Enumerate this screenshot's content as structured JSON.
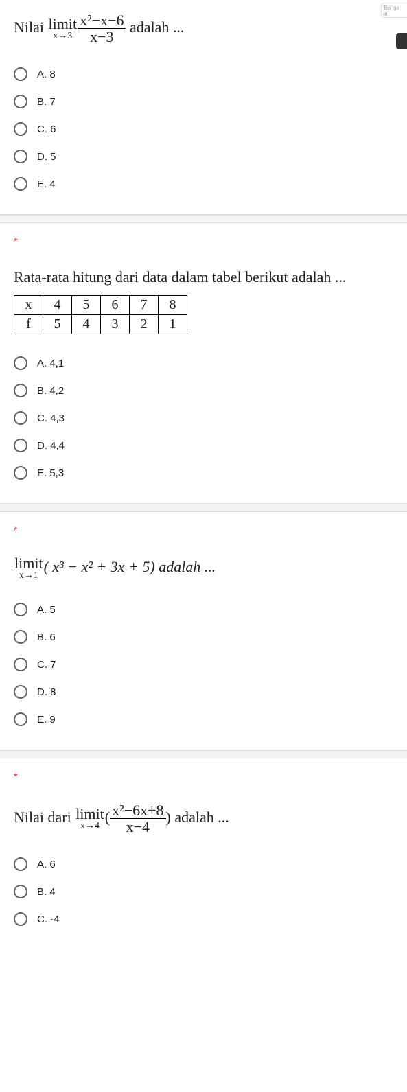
{
  "badge_text": "'Ba' ga ar",
  "required_marker": "*",
  "questions": [
    {
      "prefix": "Nilai ",
      "limit_top": "limit",
      "limit_bot": "x→3",
      "frac_num": "x²−x−6",
      "frac_den": "x−3",
      "suffix": " adalah ...",
      "options": [
        {
          "label": "A. 8"
        },
        {
          "label": "B. 7"
        },
        {
          "label": "C. 6"
        },
        {
          "label": "D. 5"
        },
        {
          "label": "E. 4"
        }
      ]
    },
    {
      "title_text": "Rata-rata hitung dari data dalam tabel berikut adalah ...",
      "table": {
        "row1": [
          "x",
          "4",
          "5",
          "6",
          "7",
          "8"
        ],
        "row2": [
          "f",
          "5",
          "4",
          "3",
          "2",
          "1"
        ]
      },
      "options": [
        {
          "label": "A. 4,1"
        },
        {
          "label": "B. 4,2"
        },
        {
          "label": "C. 4,3"
        },
        {
          "label": "D. 4,4"
        },
        {
          "label": "E. 5,3"
        }
      ]
    },
    {
      "limit_top": "limit",
      "limit_bot": "x→1",
      "expr": "( x³ − x² + 3x + 5) adalah ...",
      "options": [
        {
          "label": "A. 5"
        },
        {
          "label": "B. 6"
        },
        {
          "label": "C. 7"
        },
        {
          "label": "D. 8"
        },
        {
          "label": "E. 9"
        }
      ]
    },
    {
      "prefix": "Nilai dari ",
      "limit_top": "limit",
      "limit_bot": "x→4",
      "open": "(",
      "frac_num": "x²−6x+8",
      "frac_den": "x−4",
      "close": ")",
      "suffix": " adalah ...",
      "options": [
        {
          "label": "A. 6"
        },
        {
          "label": "B. 4"
        },
        {
          "label": "C. -4"
        }
      ]
    }
  ]
}
